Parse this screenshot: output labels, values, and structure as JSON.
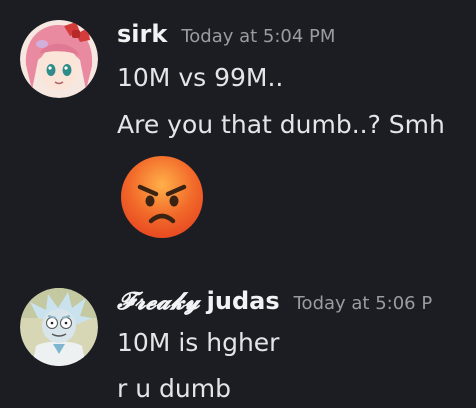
{
  "messages": [
    {
      "username": "sirk",
      "timestamp": "Today at 5:04 PM",
      "lines": [
        "10M vs 99M..",
        "Are you that dumb..? Smh"
      ],
      "emoji": "angry-face-emoji"
    },
    {
      "username_fancy": "𝓕𝓻𝓮𝓪𝓴𝔂",
      "username": "judas",
      "timestamp": "Today at 5:06 P",
      "lines": [
        "10M is hgher",
        "r u dumb"
      ]
    }
  ],
  "colors": {
    "background": "#1c1d22",
    "text": "#e3e5e8",
    "timestamp": "#9a9ca3"
  }
}
